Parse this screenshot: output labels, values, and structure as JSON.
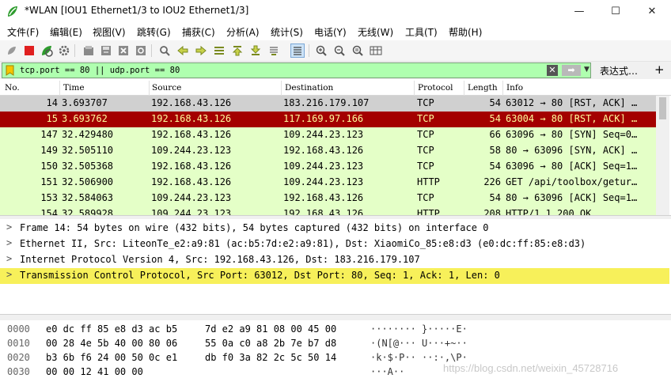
{
  "window": {
    "title": "*WLAN [IOU1 Ethernet1/3 to IOU2 Ethernet1/3]",
    "minimize": "—",
    "maximize": "☐",
    "close": "✕"
  },
  "menu": [
    "文件(F)",
    "编辑(E)",
    "视图(V)",
    "跳转(G)",
    "捕获(C)",
    "分析(A)",
    "统计(S)",
    "电话(Y)",
    "无线(W)",
    "工具(T)",
    "帮助(H)"
  ],
  "filter": {
    "expression": "tcp.port == 80 || udp.port == 80",
    "expression_button": "表达式…",
    "plus": "+",
    "clear_glyph": "✕",
    "apply_glyph": "➡",
    "dropdown_glyph": "▼",
    "bg_color": "#afffaf"
  },
  "columns": [
    "No.",
    "Time",
    "Source",
    "Destination",
    "Protocol",
    "Length",
    "Info"
  ],
  "packets": [
    {
      "no": "14",
      "time": "3.693707",
      "src": "192.168.43.126",
      "dst": "183.216.179.107",
      "proto": "TCP",
      "len": "54",
      "info": "63012 → 80 [RST, ACK] …",
      "bg": "#d0d0d0",
      "fg": "#000000"
    },
    {
      "no": "15",
      "time": "3.693762",
      "src": "192.168.43.126",
      "dst": "117.169.97.166",
      "proto": "TCP",
      "len": "54",
      "info": "63004 → 80 [RST, ACK] …",
      "bg": "#a40000",
      "fg": "#fffc9c"
    },
    {
      "no": "147",
      "time": "32.429480",
      "src": "192.168.43.126",
      "dst": "109.244.23.123",
      "proto": "TCP",
      "len": "66",
      "info": "63096 → 80 [SYN] Seq=0…",
      "bg": "#e4ffc7",
      "fg": "#000000"
    },
    {
      "no": "149",
      "time": "32.505110",
      "src": "109.244.23.123",
      "dst": "192.168.43.126",
      "proto": "TCP",
      "len": "58",
      "info": "80 → 63096 [SYN, ACK] …",
      "bg": "#e4ffc7",
      "fg": "#000000"
    },
    {
      "no": "150",
      "time": "32.505368",
      "src": "192.168.43.126",
      "dst": "109.244.23.123",
      "proto": "TCP",
      "len": "54",
      "info": "63096 → 80 [ACK] Seq=1…",
      "bg": "#e4ffc7",
      "fg": "#000000"
    },
    {
      "no": "151",
      "time": "32.506900",
      "src": "192.168.43.126",
      "dst": "109.244.23.123",
      "proto": "HTTP",
      "len": "226",
      "info": "GET /api/toolbox/getur…",
      "bg": "#e4ffc7",
      "fg": "#000000"
    },
    {
      "no": "153",
      "time": "32.584063",
      "src": "109.244.23.123",
      "dst": "192.168.43.126",
      "proto": "TCP",
      "len": "54",
      "info": "80 → 63096 [ACK] Seq=1…",
      "bg": "#e4ffc7",
      "fg": "#000000"
    },
    {
      "no": "154",
      "time": "32.589928",
      "src": "109.244.23.123",
      "dst": "192.168.43.126",
      "proto": "HTTP",
      "len": "208",
      "info": "HTTP/1.1 200 OK",
      "bg": "#e4ffc7",
      "fg": "#000000"
    }
  ],
  "details": [
    {
      "text": "Frame 14: 54 bytes on wire (432 bits), 54 bytes captured (432 bits) on interface 0",
      "highlight": false
    },
    {
      "text": "Ethernet II, Src: LiteonTe_e2:a9:81 (ac:b5:7d:e2:a9:81), Dst: XiaomiCo_85:e8:d3 (e0:dc:ff:85:e8:d3)",
      "highlight": false
    },
    {
      "text": "Internet Protocol Version 4, Src: 192.168.43.126, Dst: 183.216.179.107",
      "highlight": false
    },
    {
      "text": "Transmission Control Protocol, Src Port: 63012, Dst Port: 80, Seq: 1, Ack: 1, Len: 0",
      "highlight": true
    }
  ],
  "details_arrow": ">",
  "bytes": [
    {
      "offset": "0000",
      "hex1": "e0 dc ff 85 e8 d3 ac b5",
      "hex2": "7d e2 a9 81 08 00 45 00",
      "ascii": "········ }·····E·"
    },
    {
      "offset": "0010",
      "hex1": "00 28 4e 5b 40 00 80 06",
      "hex2": "55 0a c0 a8 2b 7e b7 d8",
      "ascii": "·(N[@··· U···+~··"
    },
    {
      "offset": "0020",
      "hex1": "b3 6b f6 24 00 50 0c e1",
      "hex2": "db f0 3a 82 2c 5c 50 14",
      "ascii": "·k·$·P·· ··:·,\\P·"
    },
    {
      "offset": "0030",
      "hex1": "00 00 12 41 00 00",
      "hex2": "",
      "ascii": "···A··"
    }
  ],
  "watermark": "https://blog.csdn.net/weixin_45728716",
  "colors": {
    "selected_row_bg": "#a40000",
    "selected_row_fg": "#fffc9c",
    "green_row_bg": "#e4ffc7",
    "highlight_detail": "#f7f05a"
  }
}
